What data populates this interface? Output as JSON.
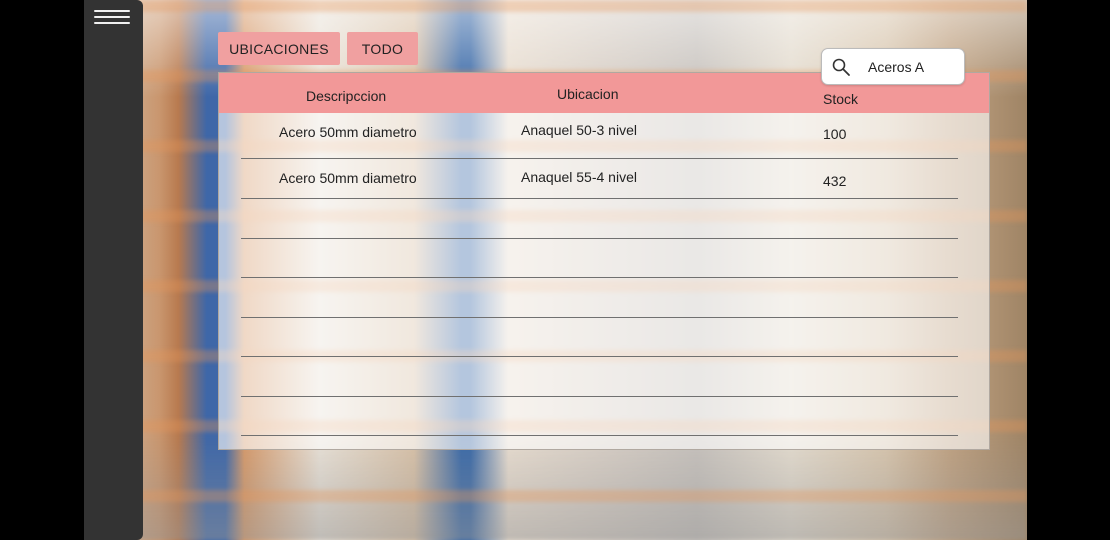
{
  "menu": {
    "icon": "hamburger-icon"
  },
  "tabs": [
    {
      "label": "UBICACIONES"
    },
    {
      "label": "TODO"
    }
  ],
  "search": {
    "value": "Aceros A",
    "icon": "search-icon"
  },
  "table": {
    "columns": [
      "Descripccion",
      "Ubicacion",
      "Stock"
    ],
    "rows": [
      {
        "descripcion": "Acero 50mm diametro",
        "ubicacion": "Anaquel 50-3 nivel",
        "stock": "100"
      },
      {
        "descripcion": "Acero 50mm diametro",
        "ubicacion": "Anaquel 55-4 nivel",
        "stock": "432"
      }
    ]
  },
  "colors": {
    "sidebar": "#333333",
    "accent": "#f29898",
    "tab": "#f0a0a0"
  }
}
